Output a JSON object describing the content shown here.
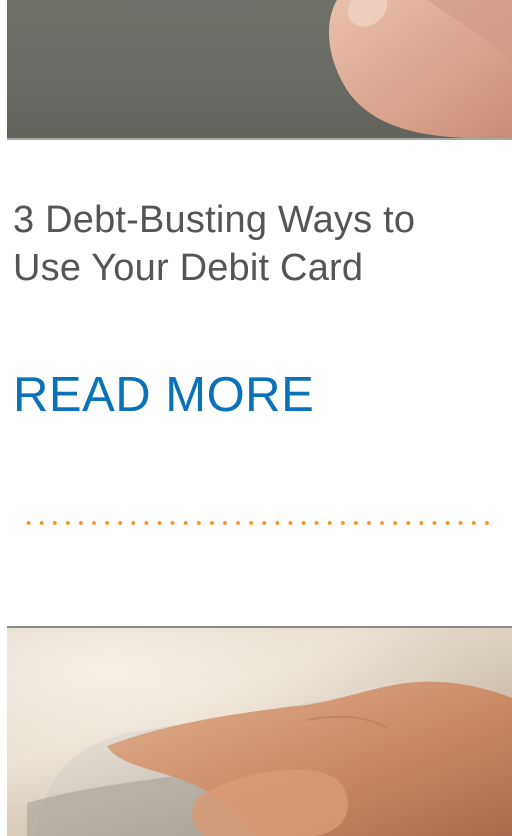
{
  "article": {
    "title": "3 Debt-Busting Ways to Use Your Debit Card",
    "read_more_label": "READ MORE"
  },
  "colors": {
    "link": "#0a72b9",
    "title_text": "#555555",
    "divider_dots": "#f29a2e"
  }
}
